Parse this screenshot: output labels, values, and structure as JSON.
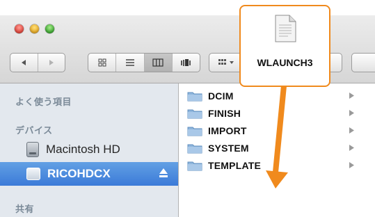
{
  "toolbar": {
    "view_buttons": [
      "icon-view",
      "list-view",
      "column-view",
      "coverflow-view"
    ],
    "active_view": "column-view"
  },
  "sidebar": {
    "sections": [
      {
        "heading": "よく使う項目"
      },
      {
        "heading": "デバイス"
      },
      {
        "heading": "共有"
      }
    ],
    "devices": [
      {
        "label": "Macintosh HD",
        "icon": "hard-drive-icon"
      },
      {
        "label": "RICOHDCX",
        "icon": "removable-drive-icon",
        "selected": true
      }
    ]
  },
  "files": {
    "folders": [
      "DCIM",
      "FINISH",
      "IMPORT",
      "SYSTEM",
      "TEMPLATE"
    ]
  },
  "drag": {
    "file_name": "WLAUNCH3",
    "highlight_color": "#f08a1d"
  },
  "colors": {
    "accent": "#f08a1d",
    "selection": "#3b7ad8",
    "sidebar_bg": "#e3e8ee"
  }
}
